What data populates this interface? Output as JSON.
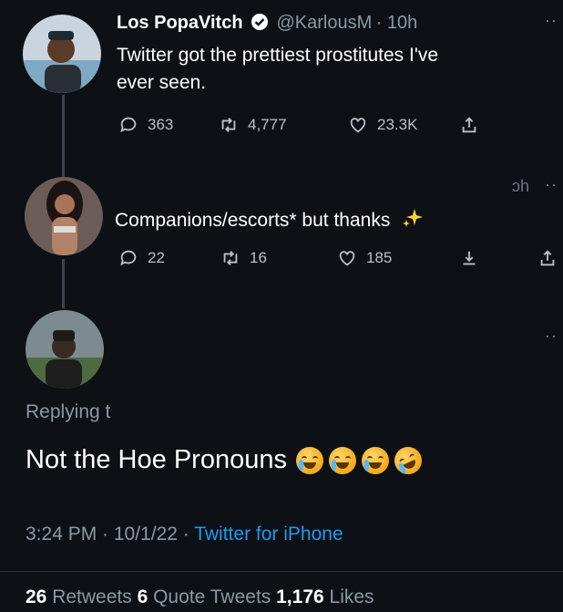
{
  "tweet1": {
    "name": "Los PopaVitch",
    "handle": "@KarlousM",
    "time": "· 10h",
    "text_line1": "Twitter got the prettiest prostitutes I've",
    "text_line2": "ever seen.",
    "replies": "363",
    "retweets": "4,777",
    "likes": "23.3K"
  },
  "tweet2": {
    "text": "Companions/escorts* but thanks",
    "time_fragment": "ɔh",
    "replies": "22",
    "retweets": "16",
    "likes": "185"
  },
  "tweet3": {
    "replying_to": "Replying t",
    "text": "Not the Hoe Pronouns",
    "timestamp": "3:24 PM · 10/1/22 · ",
    "client": "Twitter for iPhone",
    "retweet_count": "26",
    "retweet_label": " Retweets ",
    "quote_count": "6",
    "quote_label": " Quote Tweets ",
    "like_count": "1,176",
    "like_label": " Likes"
  },
  "icons": {
    "verified": "verified-badge-icon",
    "reply": "reply-icon",
    "retweet": "retweet-icon",
    "like": "heart-icon",
    "share": "share-icon",
    "sparkles": "sparkles-icon"
  },
  "colors": {
    "background": "#0d1015",
    "link": "#1d9bf0",
    "muted": "#8b98a5"
  }
}
